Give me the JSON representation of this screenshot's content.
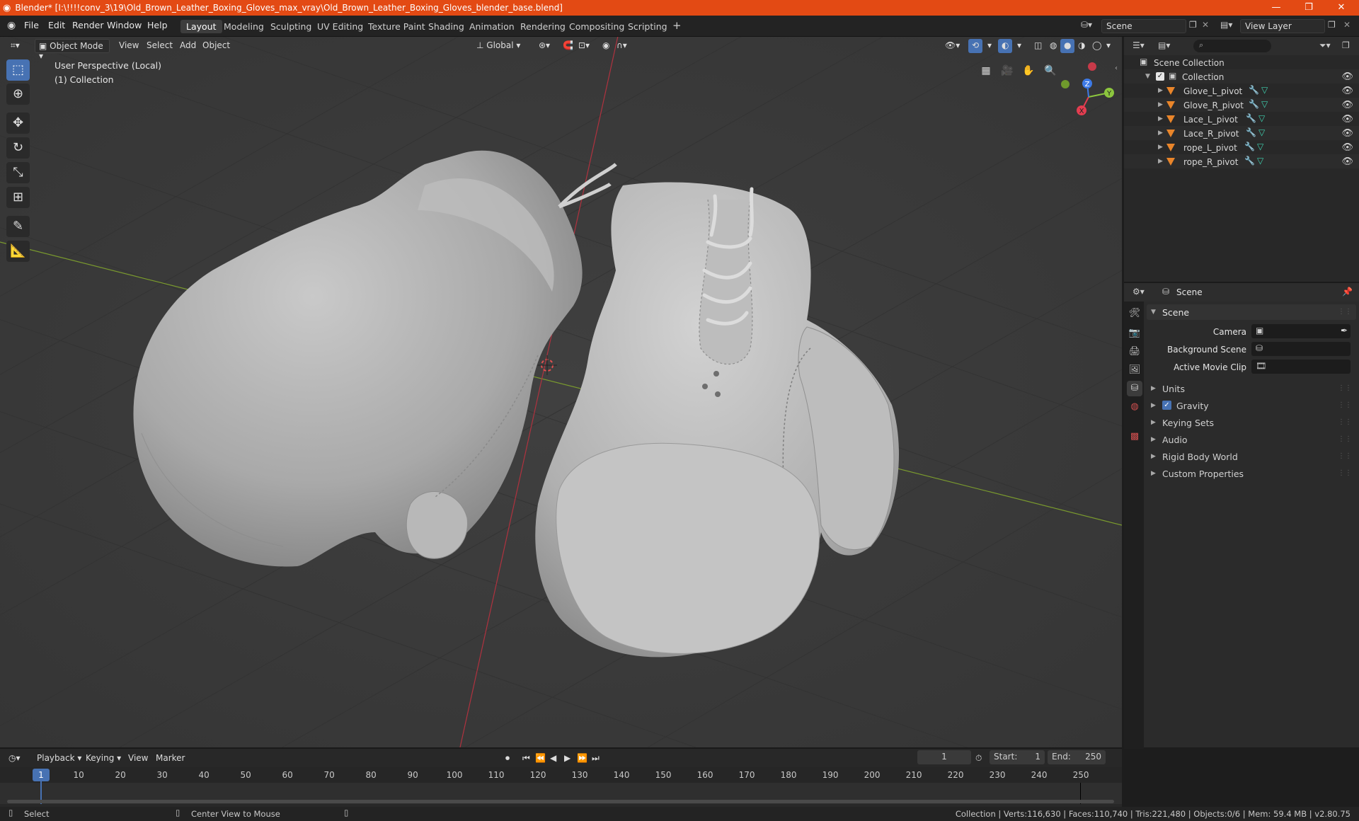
{
  "title": "Blender* [I:\\!!!!conv_3\\19\\Old_Brown_Leather_Boxing_Gloves_max_vray\\Old_Brown_Leather_Boxing_Gloves_blender_base.blend]",
  "menu": [
    "File",
    "Edit",
    "Render",
    "Window",
    "Help"
  ],
  "workspaces": [
    "Layout",
    "Modeling",
    "Sculpting",
    "UV Editing",
    "Texture Paint",
    "Shading",
    "Animation",
    "Rendering",
    "Compositing",
    "Scripting"
  ],
  "scene_field": "Scene",
  "view_layer_field": "View Layer",
  "viewport": {
    "mode": "Object Mode",
    "menus": [
      "View",
      "Select",
      "Add",
      "Object"
    ],
    "transform": "Global",
    "info_line1": "User Perspective (Local)",
    "info_line2": "(1) Collection",
    "axes": {
      "x": "X",
      "y": "Y",
      "z": "Z"
    }
  },
  "outliner": {
    "root": "Scene Collection",
    "collection": "Collection",
    "objects": [
      "Glove_L_pivot",
      "Glove_R_pivot",
      "Lace_L_pivot",
      "Lace_R_pivot",
      "rope_L_pivot",
      "rope_R_pivot"
    ]
  },
  "properties": {
    "context": "Scene",
    "panel_title": "Scene",
    "fields": [
      {
        "label": "Camera",
        "value": ""
      },
      {
        "label": "Background Scene",
        "value": ""
      },
      {
        "label": "Active Movie Clip",
        "value": ""
      }
    ],
    "subpanels": [
      "Units",
      "Gravity",
      "Keying Sets",
      "Audio",
      "Rigid Body World",
      "Custom Properties"
    ],
    "gravity_checked": true
  },
  "timeline": {
    "menus": [
      "Playback",
      "Keying",
      "View",
      "Marker"
    ],
    "current_frame": "1",
    "start_label": "Start:",
    "start": "1",
    "end_label": "End:",
    "end": "250",
    "ticks": [
      "1",
      "10",
      "20",
      "30",
      "40",
      "50",
      "60",
      "70",
      "80",
      "90",
      "100",
      "110",
      "120",
      "130",
      "140",
      "150",
      "160",
      "170",
      "180",
      "190",
      "200",
      "210",
      "220",
      "230",
      "240",
      "250"
    ]
  },
  "status": {
    "left": "Select",
    "middle": "Center View to Mouse",
    "right": "Collection | Verts:116,630 | Faces:110,740 | Tris:221,480 | Objects:0/6 | Mem: 59.4 MB | v2.80.75"
  },
  "colors": {
    "accent": "#4772b3",
    "title_bar": "#e34a14",
    "object_icon": "#e9852a",
    "x_axis": "#e43d50",
    "y_axis": "#8cc63e",
    "z_axis": "#3d7ae6"
  }
}
